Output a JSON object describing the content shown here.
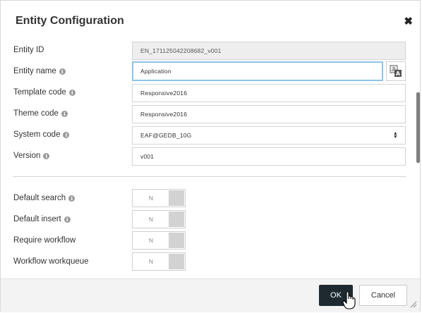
{
  "dialog": {
    "title": "Entity Configuration",
    "close_icon": "close-icon"
  },
  "fields": {
    "entity_id": {
      "label": "Entity ID",
      "value": "EN_171125042208682_v001"
    },
    "entity_name": {
      "label": "Entity name",
      "value": "Application"
    },
    "template_code": {
      "label": "Template code",
      "value": "Responsive2016"
    },
    "theme_code": {
      "label": "Theme code",
      "value": "Responsive2016"
    },
    "system_code": {
      "label": "System code",
      "value": "EAF@GEDB_10G"
    },
    "version": {
      "label": "Version",
      "value": "v001"
    }
  },
  "toggles": {
    "default_search": {
      "label": "Default search",
      "value": "N"
    },
    "default_insert": {
      "label": "Default insert",
      "value": "N"
    },
    "require_workflow": {
      "label": "Require workflow",
      "value": "N"
    },
    "workflow_workqueue": {
      "label": "Workflow workqueue",
      "value": "N"
    }
  },
  "footer": {
    "ok_label": "OK",
    "cancel_label": "Cancel"
  },
  "colors": {
    "ok_bg": "#1e2a30",
    "focus_border": "#8fc3e6",
    "readonly_bg": "#eeeeee"
  }
}
